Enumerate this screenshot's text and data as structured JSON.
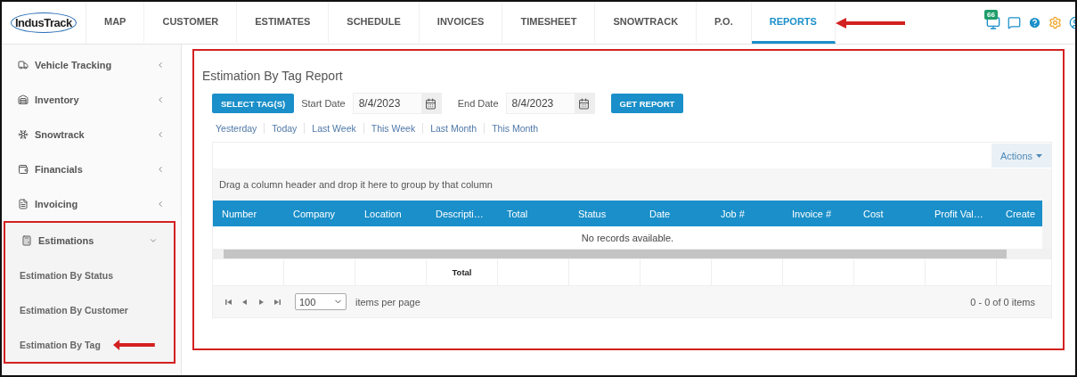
{
  "logo": {
    "text": "IndusTrack"
  },
  "nav": {
    "tabs": [
      {
        "label": "MAP",
        "selected": false
      },
      {
        "label": "CUSTOMER",
        "selected": false
      },
      {
        "label": "ESTIMATES",
        "selected": false
      },
      {
        "label": "SCHEDULE",
        "selected": false
      },
      {
        "label": "INVOICES",
        "selected": false
      },
      {
        "label": "TIMESHEET",
        "selected": false
      },
      {
        "label": "SNOWTRACK",
        "selected": false
      },
      {
        "label": "P.O.",
        "selected": false
      },
      {
        "label": "REPORTS",
        "selected": true
      }
    ],
    "notification_count": "66"
  },
  "sidebar": {
    "items": [
      {
        "kind": "truck",
        "label": "Vehicle Tracking",
        "expanded": false
      },
      {
        "kind": "inventory",
        "label": "Inventory",
        "expanded": false
      },
      {
        "kind": "snow",
        "label": "Snowtrack",
        "expanded": false
      },
      {
        "kind": "wallet",
        "label": "Financials",
        "expanded": false
      },
      {
        "kind": "document",
        "label": "Invoicing",
        "expanded": false
      },
      {
        "kind": "calculator",
        "label": "Estimations",
        "expanded": true,
        "children": [
          {
            "label": "Estimation By Status"
          },
          {
            "label": "Estimation By Customer"
          },
          {
            "label": "Estimation By Tag"
          }
        ]
      }
    ]
  },
  "report": {
    "title": "Estimation By Tag Report",
    "select_tags_button": "SELECT TAG(S)",
    "start_date": {
      "label": "Start Date",
      "value": "8/4/2023"
    },
    "end_date": {
      "label": "End Date",
      "value": "8/4/2023"
    },
    "get_report_button": "GET REPORT",
    "quick_ranges": [
      "Yesterday",
      "Today",
      "Last Week",
      "This Week",
      "Last Month",
      "This Month"
    ]
  },
  "grid": {
    "actions_button": "Actions",
    "group_hint": "Drag a column header and drop it here to group by that column",
    "columns": [
      "Number",
      "Company",
      "Location",
      "Descripti…",
      "Total",
      "Status",
      "Date",
      "Job #",
      "Invoice #",
      "Cost",
      "Profit Val…",
      "Create"
    ],
    "empty_message": "No records available.",
    "footer_total_label": "Total",
    "page_size": "100",
    "page_size_label": "items per page",
    "pager_info": "0 - 0 of 0 items"
  }
}
